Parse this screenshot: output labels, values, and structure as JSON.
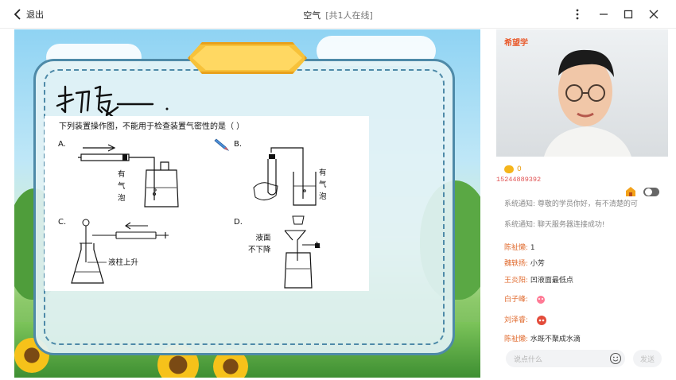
{
  "header": {
    "back_label": "退出",
    "title": "空气",
    "subtitle": "[共1人在线]"
  },
  "slide": {
    "handwriting": "拓展",
    "question": "下列装置操作图，不能用于检查装置气密性的是（    ）",
    "options": [
      "A.",
      "B.",
      "C.",
      "D."
    ],
    "labels": {
      "a": [
        "有",
        "气",
        "泡"
      ],
      "b": [
        "有",
        "气",
        "泡"
      ],
      "c": "液柱上升",
      "d": [
        "液面",
        "不下降"
      ]
    }
  },
  "video": {
    "logo": "希望学"
  },
  "chat": {
    "coins": "0",
    "phone": "15244889392",
    "messages": [
      {
        "name": "系统通知:",
        "text": " 尊敬的学员你好，有不清楚的可"
      },
      {
        "name": "系统通知:",
        "text": " 聊天服务器连接成功!"
      },
      {
        "name": "陈祉懒:",
        "text": " 1"
      },
      {
        "name": "魏轶扬:",
        "text": " 小芳"
      },
      {
        "name": "王炎阳:",
        "text": " 凹液面最低点"
      },
      {
        "name": "白子峰:",
        "text": ""
      },
      {
        "name": "刘泽睿:",
        "text": ""
      },
      {
        "name": "陈祉懒:",
        "text": " 水既不聚成水滴"
      }
    ],
    "input_placeholder": "说点什么",
    "send_label": "发送"
  },
  "colors": {
    "brand": "#e95b2d",
    "name": "#e06a2d",
    "board_border": "#4e8aa8",
    "hexagon": "#f7c23a"
  },
  "icons": [
    "chevron-left-icon",
    "more-vertical-icon",
    "minimize-icon",
    "maximize-icon",
    "close-icon",
    "pencil-icon",
    "gift-icon",
    "emoji-icon",
    "coin-icon"
  ]
}
